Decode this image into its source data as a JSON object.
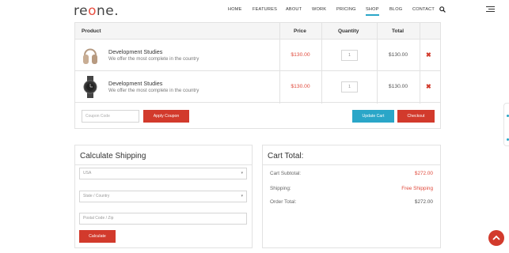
{
  "header": {
    "logo": {
      "part1": "re",
      "part2": "o",
      "part3": "ne."
    },
    "nav": [
      "HOME",
      "FEATURES",
      "ABOUT",
      "WORK",
      "PRICING",
      "SHOP",
      "BLOG",
      "CONTACT"
    ],
    "active_nav": "SHOP",
    "icons": {
      "search": "search-icon",
      "menu": "hamburger-menu-icon"
    }
  },
  "cart": {
    "columns": {
      "product": "Product",
      "price": "Price",
      "quantity": "Quantity",
      "total": "Total"
    },
    "rows": [
      {
        "name": "Development Studies",
        "description": "We offer the most complete in the country",
        "price": "$130.00",
        "quantity": "1",
        "total": "$130.00",
        "image": "headphones-image"
      },
      {
        "name": "Development Studies",
        "description": "We offer the most complete in the country",
        "price": "$130.00",
        "quantity": "1",
        "total": "$130.00",
        "image": "watch-image"
      }
    ],
    "coupon_placeholder": "Coupon Code",
    "apply_coupon": "Apply Coupon",
    "update_cart": "Update Cart",
    "checkout": "Checkout",
    "remove_icon": "close-icon"
  },
  "shipping": {
    "title": "Calculate Shipping",
    "country_value": "USA",
    "state_placeholder": "State / Country",
    "postal_placeholder": "Postal Code / Zip",
    "button": "Calculate"
  },
  "totals": {
    "title": "Cart Total:",
    "subtotal_label": "Cart Subtotal:",
    "subtotal_value": "$272.00",
    "shipping_label": "Shipping:",
    "shipping_value": "Free Shipping",
    "order_label": "Order Total:",
    "order_value": "$272.00"
  },
  "colors": {
    "accent_red": "#d23a2c",
    "accent_blue": "#2aa6c8"
  }
}
